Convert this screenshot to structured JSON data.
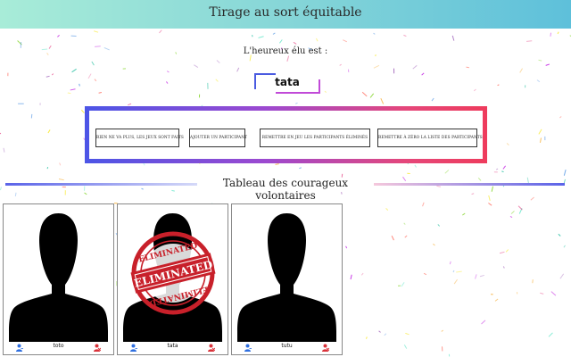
{
  "header": {
    "title": "Tirage au sort équitable"
  },
  "winner": {
    "caption": "L'heureux élu est :",
    "name": "tata"
  },
  "actions": [
    {
      "label": "Rien ne va plus, les jeux sont faits"
    },
    {
      "label": "Ajouter un participant"
    },
    {
      "label": "Remettre en jeu les participants éliminés"
    },
    {
      "label": "Remettre à zéro la liste des participants"
    }
  ],
  "section": {
    "title": "Tableau des courageux volontaires"
  },
  "participants": [
    {
      "name": "toto",
      "eliminated": false
    },
    {
      "name": "tata",
      "eliminated": true
    },
    {
      "name": "tutu",
      "eliminated": false
    }
  ],
  "stamp": {
    "text": "ELIMINATED"
  },
  "colors": {
    "header_start": "#a8ecd8",
    "header_end": "#5ec0da",
    "frame_blue": "#4c55e6",
    "frame_pink": "#ee3b5c",
    "user_icon": "#2f6fe0",
    "remove_icon": "#d9323a",
    "stamp_red": "#c8202a"
  },
  "icons": {
    "user": "user-plus-icon",
    "remove": "user-remove-icon"
  }
}
